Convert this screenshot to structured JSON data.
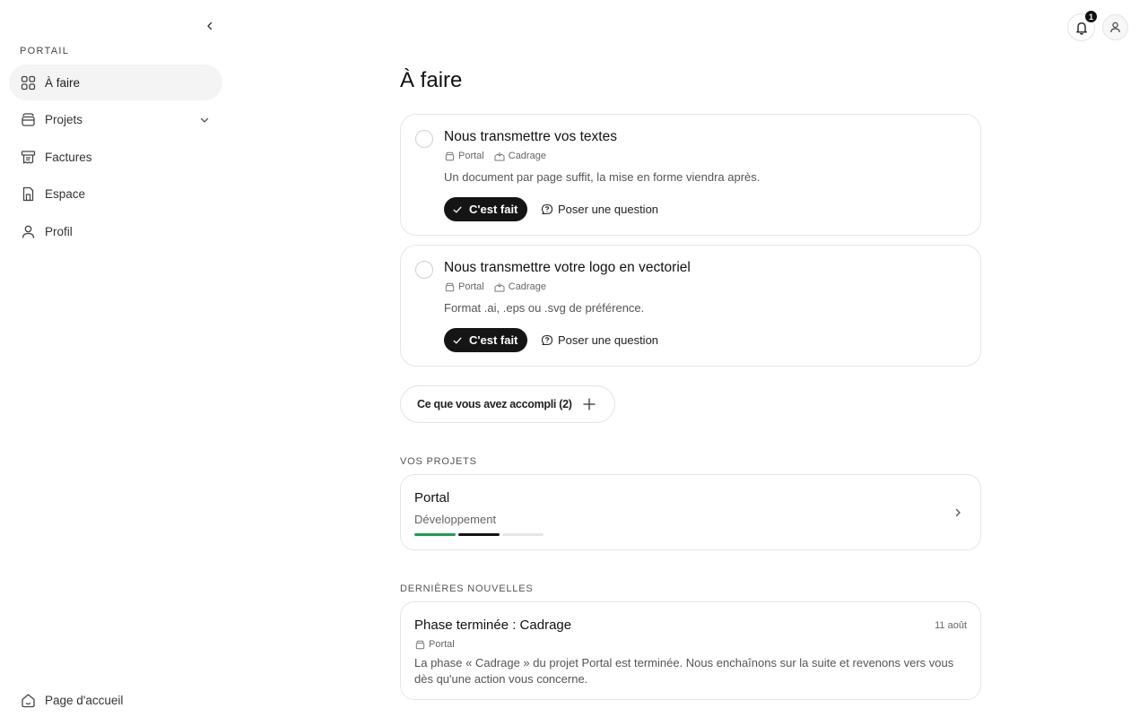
{
  "sidebar": {
    "section_label": "PORTAIL",
    "items": [
      {
        "label": "À faire",
        "icon": "grid-icon",
        "active": true
      },
      {
        "label": "Projets",
        "icon": "projects-icon",
        "expandable": true
      },
      {
        "label": "Factures",
        "icon": "invoice-icon"
      },
      {
        "label": "Espace",
        "icon": "document-icon"
      },
      {
        "label": "Profil",
        "icon": "user-icon"
      }
    ],
    "home_label": "Page d'accueil"
  },
  "topbar": {
    "notifications_count": "1"
  },
  "main": {
    "title": "À faire",
    "tasks": [
      {
        "title": "Nous transmettre vos textes",
        "project": "Portal",
        "phase": "Cadrage",
        "description": "Un document par page suffit, la mise en forme viendra après.",
        "done_label": "C'est fait",
        "ask_label": "Poser une question"
      },
      {
        "title": "Nous transmettre votre logo en vectoriel",
        "project": "Portal",
        "phase": "Cadrage",
        "description": "Format .ai, .eps ou .svg de préférence.",
        "done_label": "C'est fait",
        "ask_label": "Poser une question"
      }
    ],
    "accomplished_label": "Ce que vous avez accompli (2)",
    "projects_section_label": "VOS PROJETS",
    "project": {
      "name": "Portal",
      "phase": "Développement",
      "progress_colors": [
        "#1f9d55",
        "#151515",
        "#e6e6e6"
      ]
    },
    "news_section_label": "DERNIÈRES NOUVELLES",
    "news": {
      "title": "Phase terminée : Cadrage",
      "date": "11 août",
      "project": "Portal",
      "body": "La phase « Cadrage » du projet Portal est terminée. Nous enchaînons sur la suite et revenons vers vous dès qu'une action vous concerne."
    }
  }
}
